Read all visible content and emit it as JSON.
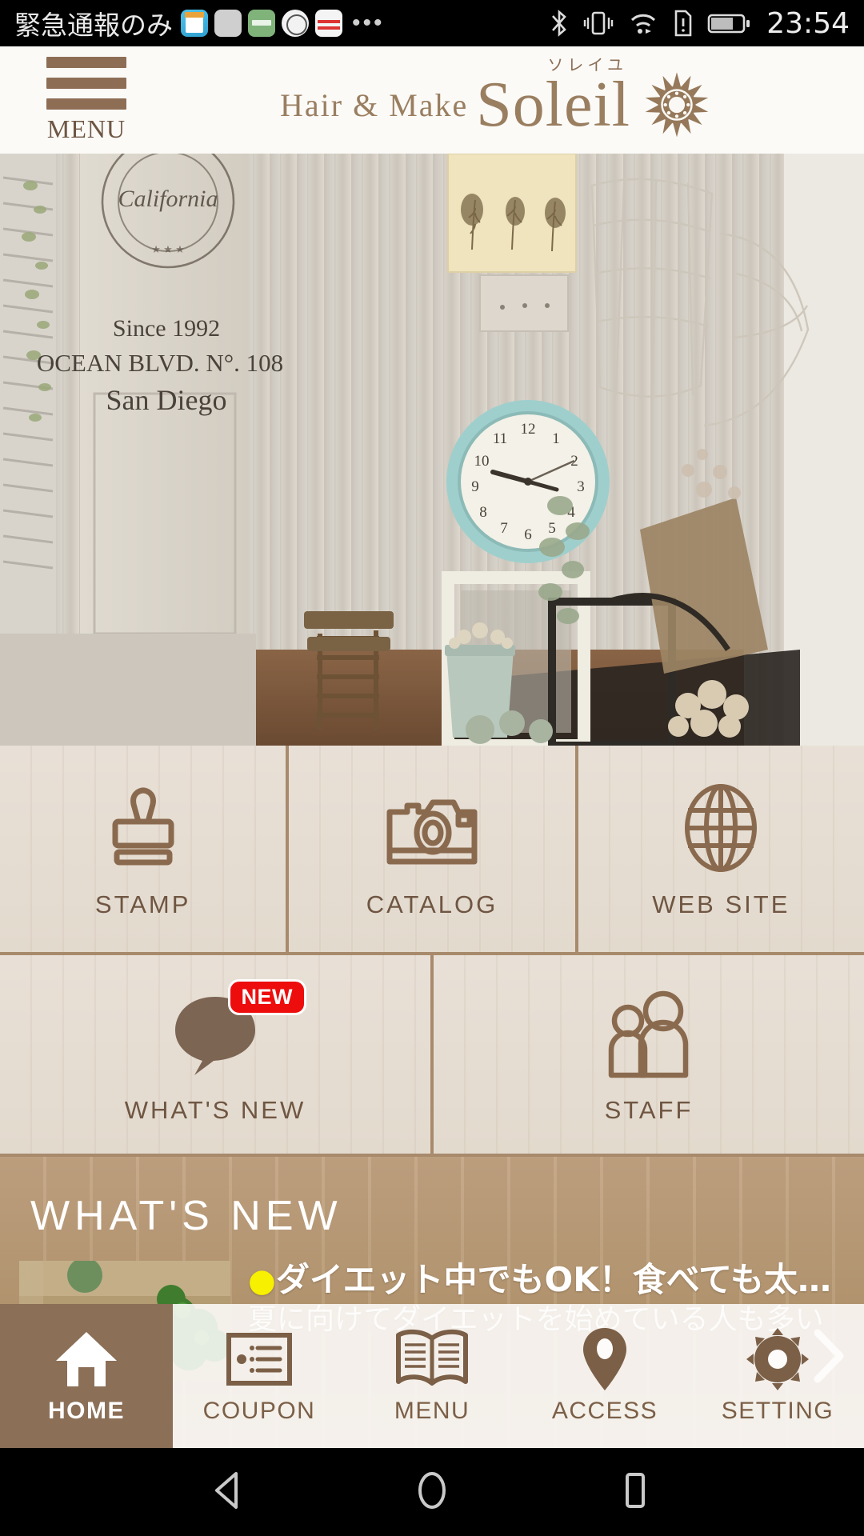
{
  "statusbar": {
    "carrier_text": "緊急通報のみ",
    "overflow_dots": "•••",
    "notification_icons": [
      "calendar-app-icon",
      "grey-app-icon",
      "green-app-icon",
      "circle-seal-app-icon",
      "bagzy-app-icon"
    ],
    "system_icons": [
      "bluetooth-icon",
      "vibrate-icon",
      "wifi-icon",
      "sim-alert-icon",
      "battery-icon"
    ],
    "time": "23:54"
  },
  "header": {
    "menu_label": "MENU",
    "logo_prefix": "Hair & Make",
    "logo_name": "Soleil",
    "logo_kana": "ソレイユ",
    "brand_color": "#9a7e60",
    "emblem": "sun-emblem-icon"
  },
  "hero": {
    "name": "salon-interior-photo",
    "stencil_line1": "California",
    "stencil_line2": "Since 1992",
    "stencil_line3": "OCEAN BLVD. N°. 108",
    "stencil_line4": "San Diego"
  },
  "tiles": {
    "row1": [
      {
        "label": "STAMP",
        "icon": "stamp-icon"
      },
      {
        "label": "CATALOG",
        "icon": "camera-icon"
      },
      {
        "label": "WEB SITE",
        "icon": "globe-icon"
      }
    ],
    "row2": [
      {
        "label": "WHAT'S NEW",
        "icon": "speech-bubble-icon",
        "badge": "NEW",
        "badge_color": "#ee0d0d"
      },
      {
        "label": "STAFF",
        "icon": "people-icon"
      }
    ]
  },
  "whats_new": {
    "section_title": "WHAT'S NEW",
    "item": {
      "bullet": "●",
      "headline": "ダイエット中でもOK！食べても太…",
      "body": "夏に向けてダイエットを始めている人も多い",
      "thumbnail": "food-plate-photo"
    },
    "next_arrow": "chevron-right-icon"
  },
  "tabbar": {
    "items": [
      {
        "label": "HOME",
        "icon": "home-icon",
        "active": true
      },
      {
        "label": "COUPON",
        "icon": "ticket-icon",
        "active": false
      },
      {
        "label": "MENU",
        "icon": "book-icon",
        "active": false
      },
      {
        "label": "ACCESS",
        "icon": "map-pin-icon",
        "active": false
      },
      {
        "label": "SETTING",
        "icon": "gear-icon",
        "active": false
      }
    ],
    "active_bg": "#8b6f57",
    "icon_color": "#7b5f47"
  },
  "android_nav": {
    "back": "back-triangle-icon",
    "home": "home-circle-icon",
    "recents": "recents-square-icon"
  }
}
